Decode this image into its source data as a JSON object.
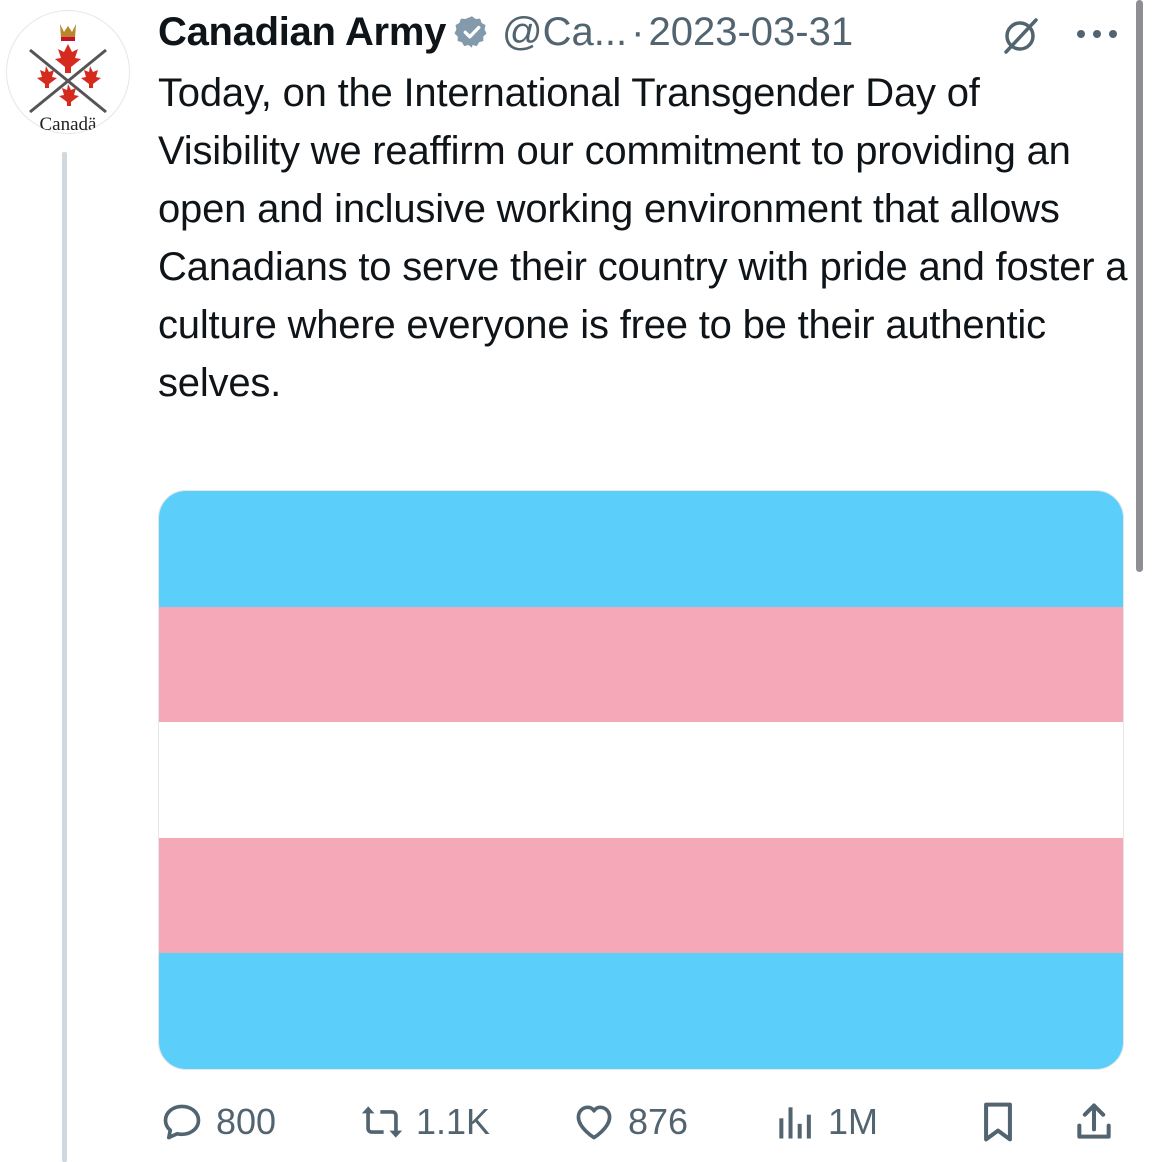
{
  "author": {
    "display_name": "Canadian Army",
    "handle": "@Ca...",
    "avatar_label": "Canadä"
  },
  "meta": {
    "separator": "·",
    "date": "2023-03-31"
  },
  "tweet": {
    "text": "Today, on the International Transgender Day of Visibility we reaffirm our commitment to providing an open and inclusive working environment that allows Canadians to serve their country with pride and foster a culture where everyone is free to be their authentic selves."
  },
  "media": {
    "icon": "transgender-flag-image",
    "stripes": [
      "#5bcefa",
      "#f5a9b8",
      "#ffffff",
      "#f5a9b8",
      "#5bcefa"
    ]
  },
  "actions": {
    "replies": "800",
    "reposts": "1.1K",
    "likes": "876",
    "views": "1M"
  },
  "colors": {
    "secondary_text": "#536471",
    "verified": "#829aab"
  }
}
